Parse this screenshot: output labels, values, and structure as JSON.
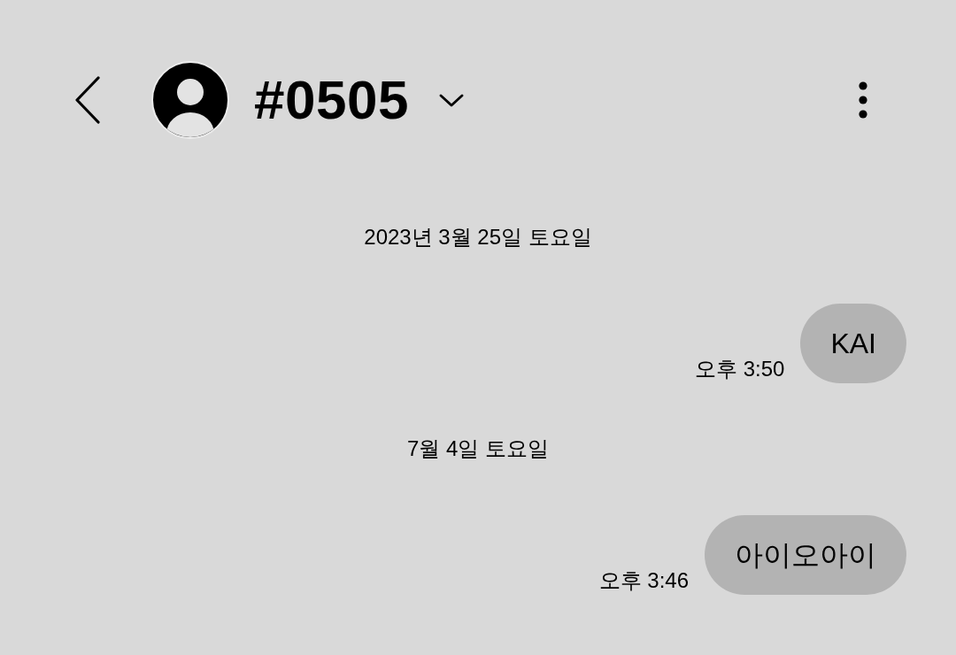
{
  "header": {
    "title": "#0505"
  },
  "days": [
    {
      "date": "2023년 3월 25일 토요일",
      "messages": [
        {
          "text": "KAI",
          "time": "오후 3:50"
        }
      ]
    },
    {
      "date": "7월 4일 토요일",
      "messages": [
        {
          "text": "아이오아이",
          "time": "오후 3:46"
        }
      ]
    }
  ]
}
